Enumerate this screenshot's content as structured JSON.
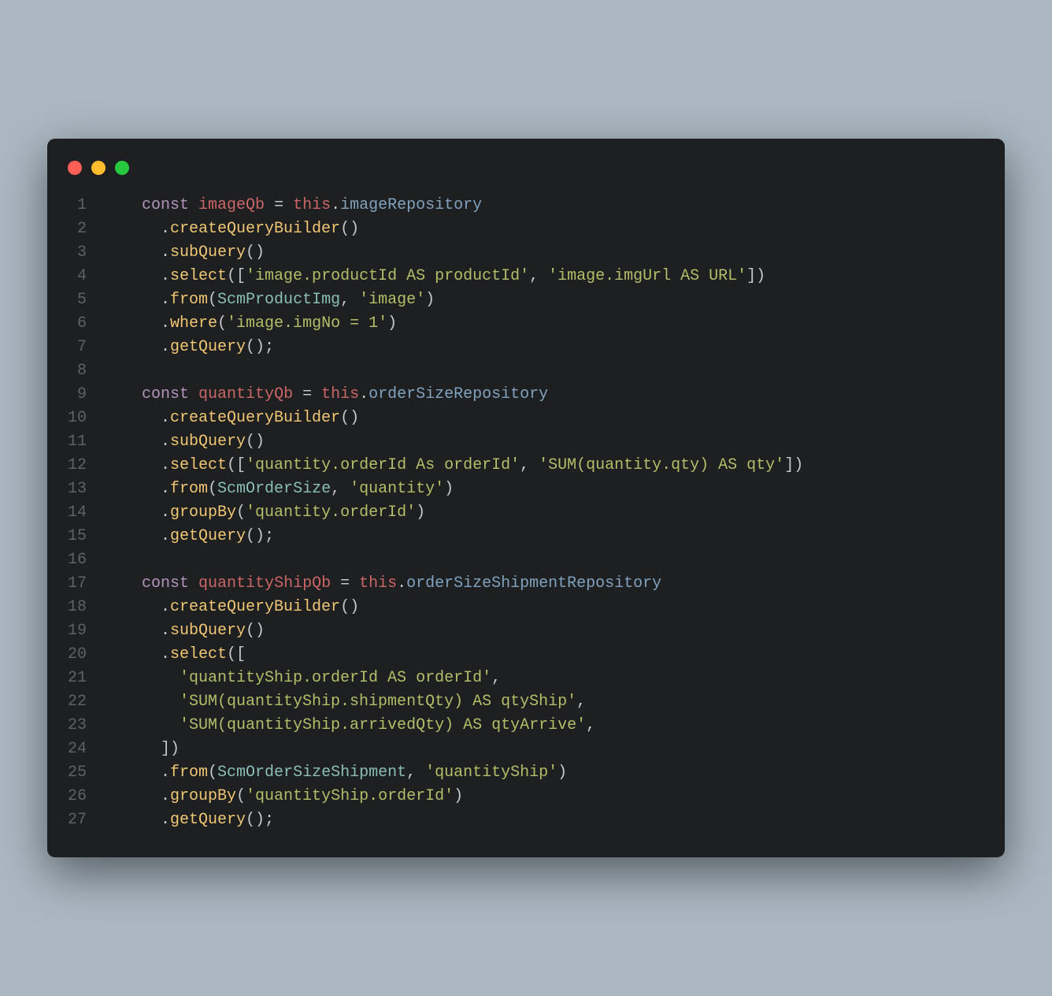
{
  "traffic": [
    "red",
    "yellow",
    "green"
  ],
  "lineNumbers": [
    "1",
    "2",
    "3",
    "4",
    "5",
    "6",
    "7",
    "8",
    "9",
    "10",
    "11",
    "12",
    "13",
    "14",
    "15",
    "16",
    "17",
    "18",
    "19",
    "20",
    "21",
    "22",
    "23",
    "24",
    "25",
    "26",
    "27"
  ],
  "code": {
    "l1": {
      "indent": "    ",
      "kw": "const",
      "var": "imageQb",
      "eq": " = ",
      "this": "this",
      "dot": ".",
      "prop": "imageRepository"
    },
    "l2": {
      "indent": "      .",
      "method": "createQueryBuilder",
      "paren": "()"
    },
    "l3": {
      "indent": "      .",
      "method": "subQuery",
      "paren": "()"
    },
    "l4": {
      "indent": "      .",
      "method": "select",
      "open": "([",
      "s1": "'image.productId AS productId'",
      "comma": ", ",
      "s2": "'image.imgUrl AS URL'",
      "close": "])"
    },
    "l5": {
      "indent": "      .",
      "method": "from",
      "open": "(",
      "class": "ScmProductImg",
      "comma": ", ",
      "s1": "'image'",
      "close": ")"
    },
    "l6": {
      "indent": "      .",
      "method": "where",
      "open": "(",
      "s1": "'image.imgNo = 1'",
      "close": ")"
    },
    "l7": {
      "indent": "      .",
      "method": "getQuery",
      "paren": "();"
    },
    "l8": {
      "indent": " "
    },
    "l9": {
      "indent": "    ",
      "kw": "const",
      "var": "quantityQb",
      "eq": " = ",
      "this": "this",
      "dot": ".",
      "prop": "orderSizeRepository"
    },
    "l10": {
      "indent": "      .",
      "method": "createQueryBuilder",
      "paren": "()"
    },
    "l11": {
      "indent": "      .",
      "method": "subQuery",
      "paren": "()"
    },
    "l12": {
      "indent": "      .",
      "method": "select",
      "open": "([",
      "s1": "'quantity.orderId As orderId'",
      "comma": ", ",
      "s2": "'SUM(quantity.qty) AS qty'",
      "close": "])"
    },
    "l13": {
      "indent": "      .",
      "method": "from",
      "open": "(",
      "class": "ScmOrderSize",
      "comma": ", ",
      "s1": "'quantity'",
      "close": ")"
    },
    "l14": {
      "indent": "      .",
      "method": "groupBy",
      "open": "(",
      "s1": "'quantity.orderId'",
      "close": ")"
    },
    "l15": {
      "indent": "      .",
      "method": "getQuery",
      "paren": "();"
    },
    "l16": {
      "indent": " "
    },
    "l17": {
      "indent": "    ",
      "kw": "const",
      "var": "quantityShipQb",
      "eq": " = ",
      "this": "this",
      "dot": ".",
      "prop": "orderSizeShipmentRepository"
    },
    "l18": {
      "indent": "      .",
      "method": "createQueryBuilder",
      "paren": "()"
    },
    "l19": {
      "indent": "      .",
      "method": "subQuery",
      "paren": "()"
    },
    "l20": {
      "indent": "      .",
      "method": "select",
      "paren": "(["
    },
    "l21": {
      "indent": "        ",
      "s1": "'quantityShip.orderId AS orderId'",
      "comma": ","
    },
    "l22": {
      "indent": "        ",
      "s1": "'SUM(quantityShip.shipmentQty) AS qtyShip'",
      "comma": ","
    },
    "l23": {
      "indent": "        ",
      "s1": "'SUM(quantityShip.arrivedQty) AS qtyArrive'",
      "comma": ","
    },
    "l24": {
      "indent": "      ",
      "paren": "])"
    },
    "l25": {
      "indent": "      .",
      "method": "from",
      "open": "(",
      "class": "ScmOrderSizeShipment",
      "comma": ", ",
      "s1": "'quantityShip'",
      "close": ")"
    },
    "l26": {
      "indent": "      .",
      "method": "groupBy",
      "open": "(",
      "s1": "'quantityShip.orderId'",
      "close": ")"
    },
    "l27": {
      "indent": "      .",
      "method": "getQuery",
      "paren": "();"
    }
  }
}
